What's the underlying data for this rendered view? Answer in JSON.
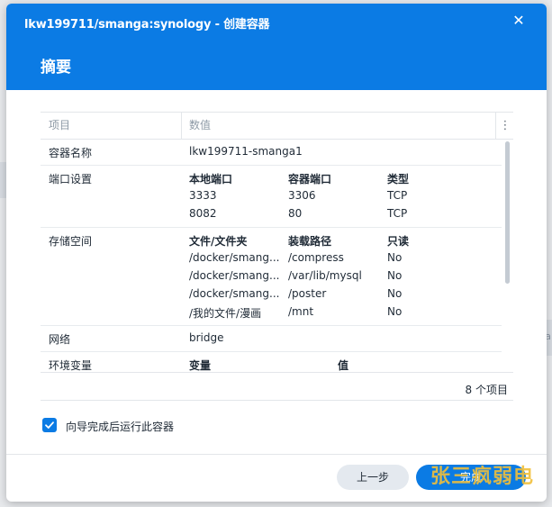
{
  "window": {
    "title": "lkw199711/smanga:synology - 创建容器",
    "close_glyph": "✕"
  },
  "step_title": "摘要",
  "table": {
    "headers": [
      "项目",
      "数值"
    ],
    "menu_glyph": "⋮",
    "rows": {
      "name": {
        "label": "容器名称",
        "value": "lkw199711-smanga1"
      },
      "ports": {
        "label": "端口设置",
        "headers": [
          "本地端口",
          "容器端口",
          "类型"
        ],
        "items": [
          [
            "3333",
            "3306",
            "TCP"
          ],
          [
            "8082",
            "80",
            "TCP"
          ]
        ]
      },
      "storage": {
        "label": "存储空间",
        "headers": [
          "文件/文件夹",
          "装载路径",
          "只读"
        ],
        "items": [
          [
            "/docker/smang...",
            "/compress",
            "No"
          ],
          [
            "/docker/smang...",
            "/var/lib/mysql",
            "No"
          ],
          [
            "/docker/smang...",
            "/poster",
            "No"
          ],
          [
            "/我的文件/漫画",
            "/mnt",
            "No"
          ]
        ]
      },
      "network": {
        "label": "网络",
        "value": "bridge"
      },
      "env": {
        "label": "环境变量",
        "headers": [
          "变量",
          "值"
        ]
      }
    },
    "count": "8 个项目"
  },
  "run_after": {
    "checked": true,
    "label": "向导完成后运行此容器"
  },
  "buttons": {
    "back": "上一步",
    "next": "完成"
  },
  "watermark": "张三疯弱电",
  "background_hint": "ia",
  "colors": {
    "accent": "#0b7be4",
    "watermark": "#f1bf3a"
  }
}
